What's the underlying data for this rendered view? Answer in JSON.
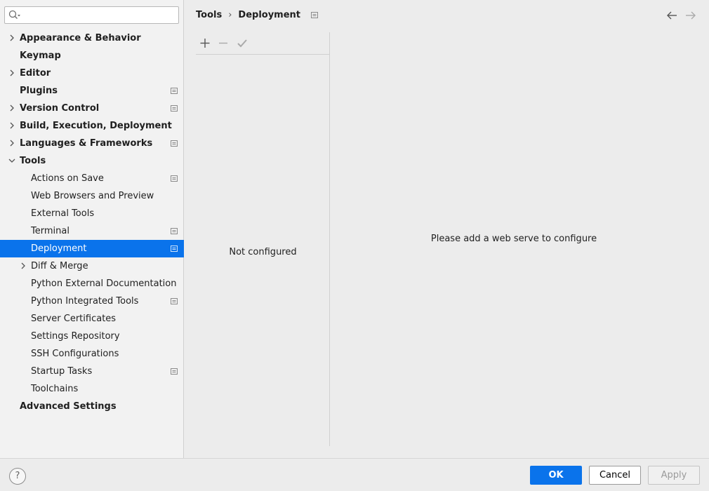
{
  "search": {
    "placeholder": "",
    "value": ""
  },
  "breadcrumb": {
    "parent": "Tools",
    "current": "Deployment"
  },
  "tree": [
    {
      "label": "Appearance & Behavior",
      "level": 0,
      "bold": true,
      "expandable": true,
      "expanded": false,
      "project": false
    },
    {
      "label": "Keymap",
      "level": 0,
      "bold": true,
      "expandable": false,
      "project": false
    },
    {
      "label": "Editor",
      "level": 0,
      "bold": true,
      "expandable": true,
      "expanded": false,
      "project": false
    },
    {
      "label": "Plugins",
      "level": 0,
      "bold": true,
      "expandable": false,
      "project": true
    },
    {
      "label": "Version Control",
      "level": 0,
      "bold": true,
      "expandable": true,
      "expanded": false,
      "project": true
    },
    {
      "label": "Build, Execution, Deployment",
      "level": 0,
      "bold": true,
      "expandable": true,
      "expanded": false,
      "project": false
    },
    {
      "label": "Languages & Frameworks",
      "level": 0,
      "bold": true,
      "expandable": true,
      "expanded": false,
      "project": true
    },
    {
      "label": "Tools",
      "level": 0,
      "bold": true,
      "expandable": true,
      "expanded": true,
      "project": false
    },
    {
      "label": "Actions on Save",
      "level": 1,
      "bold": false,
      "expandable": false,
      "project": true
    },
    {
      "label": "Web Browsers and Preview",
      "level": 1,
      "bold": false,
      "expandable": false,
      "project": false
    },
    {
      "label": "External Tools",
      "level": 1,
      "bold": false,
      "expandable": false,
      "project": false
    },
    {
      "label": "Terminal",
      "level": 1,
      "bold": false,
      "expandable": false,
      "project": true
    },
    {
      "label": "Deployment",
      "level": 1,
      "bold": false,
      "expandable": false,
      "project": true,
      "selected": true
    },
    {
      "label": "Diff & Merge",
      "level": 1,
      "bold": false,
      "expandable": true,
      "expanded": false,
      "project": false
    },
    {
      "label": "Python External Documentation",
      "level": 1,
      "bold": false,
      "expandable": false,
      "project": false
    },
    {
      "label": "Python Integrated Tools",
      "level": 1,
      "bold": false,
      "expandable": false,
      "project": true
    },
    {
      "label": "Server Certificates",
      "level": 1,
      "bold": false,
      "expandable": false,
      "project": false
    },
    {
      "label": "Settings Repository",
      "level": 1,
      "bold": false,
      "expandable": false,
      "project": false
    },
    {
      "label": "SSH Configurations",
      "level": 1,
      "bold": false,
      "expandable": false,
      "project": false
    },
    {
      "label": "Startup Tasks",
      "level": 1,
      "bold": false,
      "expandable": false,
      "project": true
    },
    {
      "label": "Toolchains",
      "level": 1,
      "bold": false,
      "expandable": false,
      "project": false
    },
    {
      "label": "Advanced Settings",
      "level": 0,
      "bold": true,
      "expandable": false,
      "project": false
    }
  ],
  "servers": {
    "empty_label": "Not configured"
  },
  "content": {
    "empty_message": "Please add a web serve to configure"
  },
  "footer": {
    "help_label": "?",
    "ok_label": "OK",
    "cancel_label": "Cancel",
    "apply_label": "Apply"
  },
  "colors": {
    "accent": "#0a73eb",
    "sidebar_bg": "#f2f2f2",
    "content_bg": "#ececec"
  }
}
